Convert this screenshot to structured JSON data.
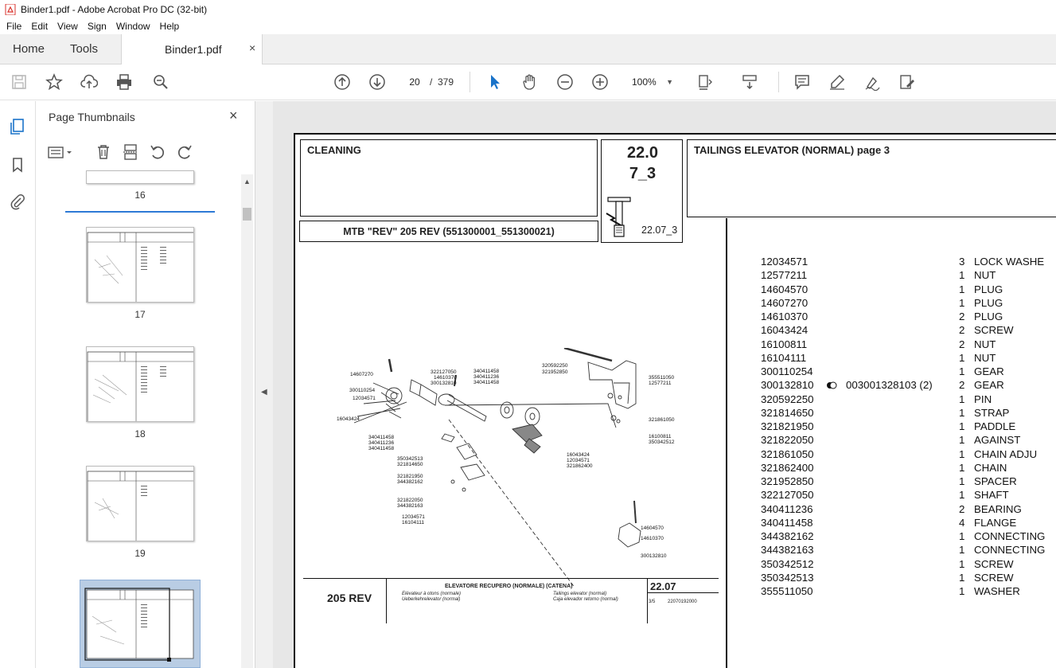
{
  "window": {
    "title": "Binder1.pdf - Adobe Acrobat Pro DC (32-bit)"
  },
  "menu": [
    "File",
    "Edit",
    "View",
    "Sign",
    "Window",
    "Help"
  ],
  "tabs": {
    "home": "Home",
    "tools": "Tools",
    "document": "Binder1.pdf",
    "close": "×"
  },
  "toolbar": {
    "page_current": "20",
    "page_separator": "/",
    "page_total": "379",
    "zoom": "100%"
  },
  "panel": {
    "title": "Page Thumbnails",
    "close": "×",
    "thumbnails": [
      {
        "label": "16"
      },
      {
        "label": "17"
      },
      {
        "label": "18"
      },
      {
        "label": "19"
      }
    ]
  },
  "document": {
    "header": {
      "section": "CLEANING",
      "model_line": "MTB \"REV\" 205 REV (551300001_551300021)",
      "code_main_1": "22.0",
      "code_main_2": "7_3",
      "code_sub": "22.07_3",
      "title": "TAILINGS ELEVATOR (NORMAL)  page 3"
    },
    "parts": [
      {
        "pn": "12034571",
        "qty": "3",
        "desc": "LOCK WASHE"
      },
      {
        "pn": "12577211",
        "qty": "1",
        "desc": "NUT"
      },
      {
        "pn": "14604570",
        "qty": "1",
        "desc": "PLUG"
      },
      {
        "pn": "14607270",
        "qty": "1",
        "desc": "PLUG"
      },
      {
        "pn": "14610370",
        "qty": "2",
        "desc": "PLUG"
      },
      {
        "pn": "16043424",
        "qty": "2",
        "desc": "SCREW"
      },
      {
        "pn": "16100811",
        "qty": "2",
        "desc": "NUT"
      },
      {
        "pn": "16104111",
        "qty": "1",
        "desc": "NUT"
      },
      {
        "pn": "300110254",
        "qty": "1",
        "desc": "GEAR"
      },
      {
        "pn": "300132810",
        "qty": "2",
        "desc": "GEAR",
        "note": "003001328103  (2)"
      },
      {
        "pn": "320592250",
        "qty": "1",
        "desc": "PIN"
      },
      {
        "pn": "321814650",
        "qty": "1",
        "desc": "STRAP"
      },
      {
        "pn": "321821950",
        "qty": "1",
        "desc": "PADDLE"
      },
      {
        "pn": "321822050",
        "qty": "1",
        "desc": "AGAINST"
      },
      {
        "pn": "321861050",
        "qty": "1",
        "desc": "CHAIN ADJU"
      },
      {
        "pn": "321862400",
        "qty": "1",
        "desc": "CHAIN"
      },
      {
        "pn": "321952850",
        "qty": "1",
        "desc": "SPACER"
      },
      {
        "pn": "322127050",
        "qty": "1",
        "desc": "SHAFT"
      },
      {
        "pn": "340411236",
        "qty": "2",
        "desc": "BEARING"
      },
      {
        "pn": "340411458",
        "qty": "4",
        "desc": "FLANGE"
      },
      {
        "pn": "344382162",
        "qty": "1",
        "desc": "CONNECTING"
      },
      {
        "pn": "344382163",
        "qty": "1",
        "desc": "CONNECTING"
      },
      {
        "pn": "350342512",
        "qty": "1",
        "desc": "SCREW"
      },
      {
        "pn": "350342513",
        "qty": "1",
        "desc": "SCREW"
      },
      {
        "pn": "355511050",
        "qty": "1",
        "desc": "WASHER"
      }
    ],
    "drawing_labels": {
      "l1": "14607270",
      "l2": "300110254",
      "l3": "12034571",
      "l4": "16043424",
      "l5": "322127050",
      "l6": "14610370",
      "l7": "300132810",
      "l8": "340411458",
      "l9": "340411236",
      "l10": "340411458",
      "l11": "320592250",
      "l12": "321952850",
      "l13": "355511050",
      "l14": "12577211",
      "l15": "321861050",
      "l16": "16100811",
      "l17": "350342512",
      "l18": "340411458",
      "l19": "340411236",
      "l20": "340411458",
      "l21": "16043424",
      "l22": "12034571",
      "l23": "321862400",
      "l24": "350342513",
      "l25": "321814650",
      "l26": "321821950",
      "l27": "344382162",
      "l28": "321822050",
      "l29": "344382163",
      "l30": "12034571",
      "l31": "16104111",
      "l32": "14604570",
      "l33": "14610370",
      "l34": "300132810"
    },
    "footer": {
      "model": "205 REV",
      "title_it": "ELEVATORE RECUPERO  (NORMALE) (CATENA)",
      "title_fr": "Elévateur à otons (normale)",
      "title_de": "Ueberkehrelevator (normal)",
      "title_en": "Tailings elevator (normal)",
      "title_es": "Caja elevador retorno (normal)",
      "code": "22.07",
      "fraction": "3/5",
      "number": "22070192000"
    }
  }
}
